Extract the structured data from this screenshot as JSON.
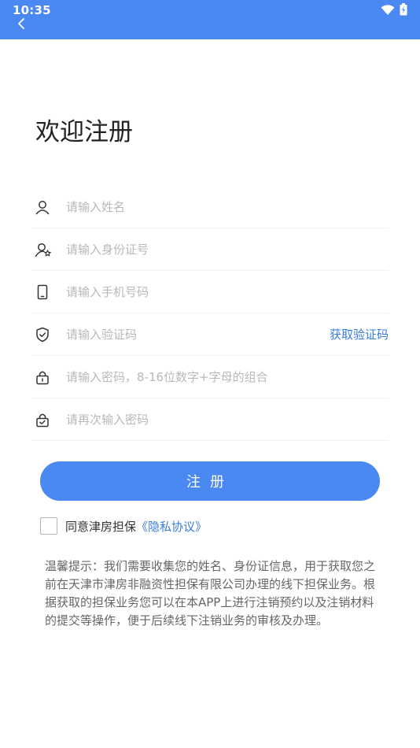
{
  "status_bar": {
    "time": "10:35",
    "icons": [
      "wifi-icon",
      "battery-icon"
    ],
    "background": "#4a88f2"
  },
  "header": {
    "back_icon": "chevron-left-icon"
  },
  "page": {
    "title": "欢迎注册"
  },
  "form": {
    "name": {
      "placeholder": "请输入姓名",
      "icon": "user-icon"
    },
    "id_number": {
      "placeholder": "请输入身份证号",
      "icon": "user-badge-icon"
    },
    "phone": {
      "placeholder": "请输入手机号码",
      "icon": "phone-icon"
    },
    "code": {
      "placeholder": "请输入验证码",
      "icon": "shield-check-icon",
      "action_label": "获取验证码"
    },
    "password": {
      "placeholder": "请输入密码，8-16位数字+字母的组合",
      "icon": "lock-icon"
    },
    "confirm_password": {
      "placeholder": "请再次输入密码",
      "icon": "lock-check-icon"
    }
  },
  "register_button": {
    "label": "注册"
  },
  "agreement": {
    "text": "同意津房担保",
    "link": "《隐私协议》",
    "checked": false
  },
  "tip": {
    "text": "温馨提示：我们需要收集您的姓名、身份证信息，用于获取您之前在天津市津房非融资性担保有限公司办理的线下担保业务。根据获取的担保业务您可以在本APP上进行注销预约以及注销材料的提交等操作，便于后续线下注销业务的审核及办理。"
  },
  "colors": {
    "accent": "#4a88f2",
    "link": "#3a7be0"
  }
}
